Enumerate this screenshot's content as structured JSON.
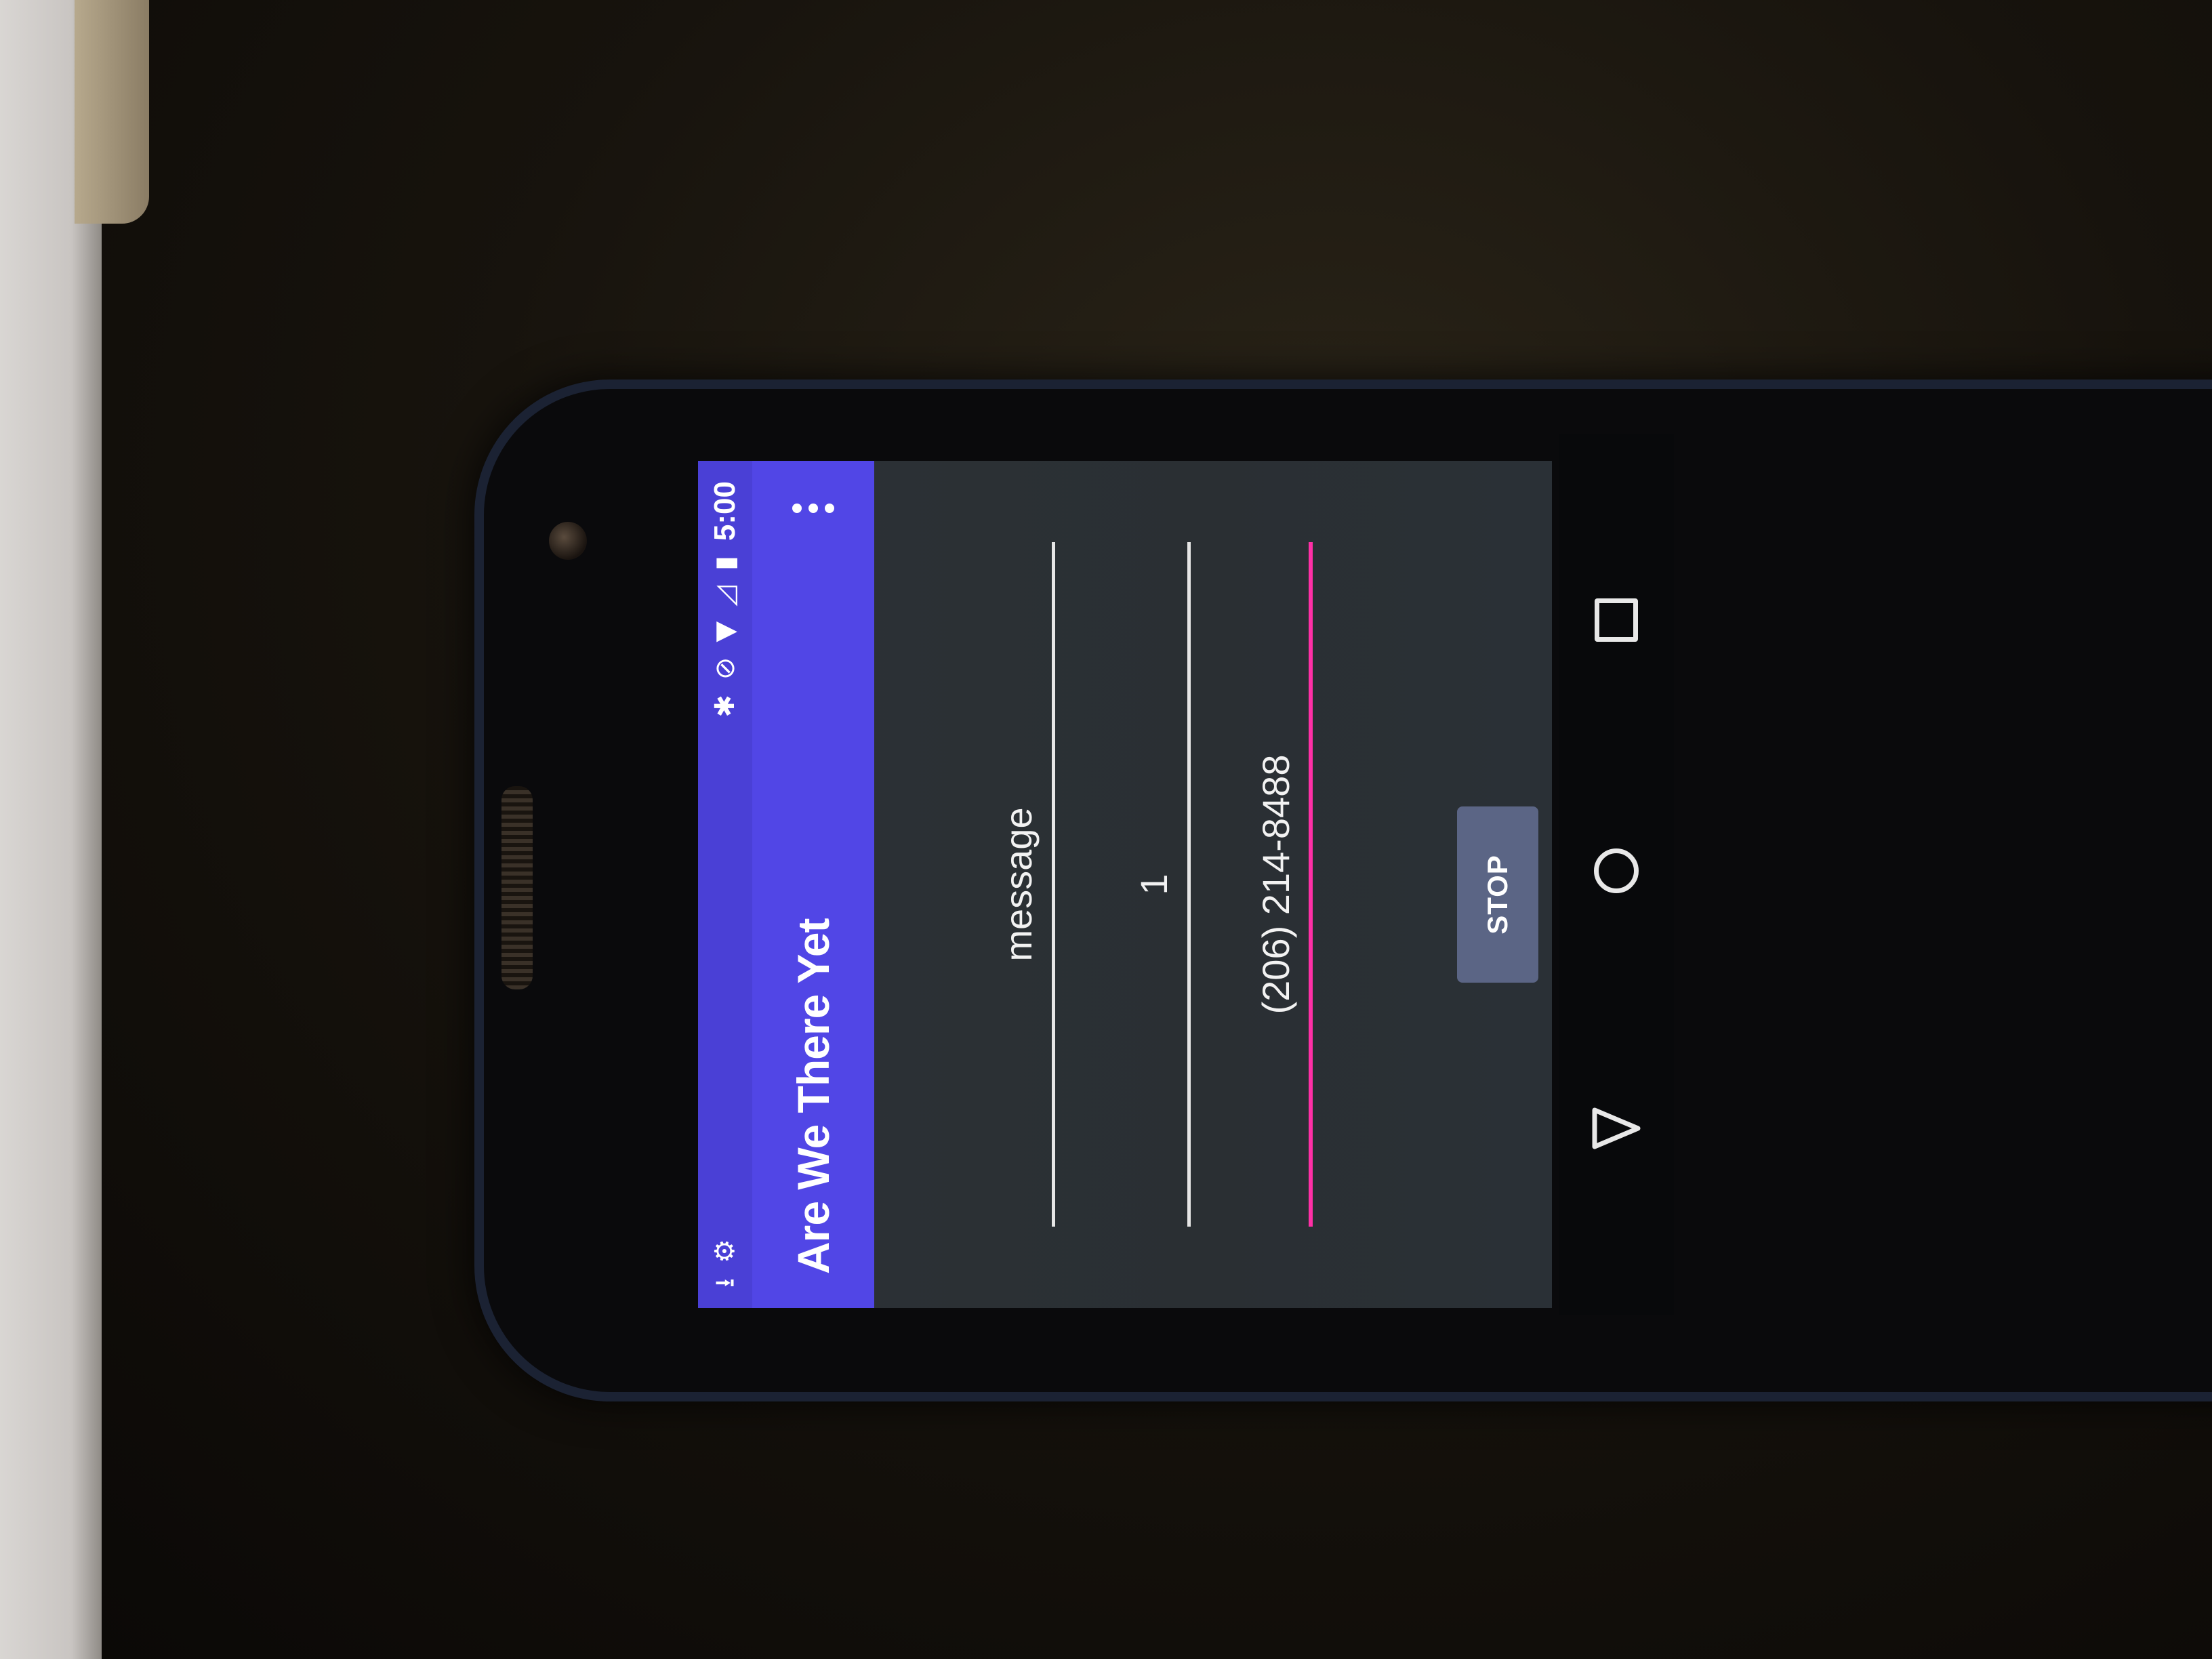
{
  "status_bar": {
    "left_icons": [
      "download-icon",
      "android-debug-icon"
    ],
    "right_icons": [
      "bluetooth-icon",
      "do-not-disturb-icon",
      "wifi-icon",
      "signal-icon",
      "battery-charging-icon"
    ],
    "time": "5:00"
  },
  "app_bar": {
    "title": "Are We There Yet",
    "overflow_icon": "overflow-menu-icon"
  },
  "form": {
    "message_value": "message",
    "interval_value": "1",
    "phone_value": "(206) 214-8488"
  },
  "actions": {
    "stop_label": "STOP"
  },
  "nav_bar": {
    "buttons": [
      "recent-apps-icon",
      "home-icon",
      "back-icon"
    ]
  },
  "colors": {
    "status_bar": "#4a40d6",
    "app_bar": "#5146e6",
    "background": "#2c3136",
    "focus_underline": "#ff2fa6",
    "button": "#5b6585"
  }
}
